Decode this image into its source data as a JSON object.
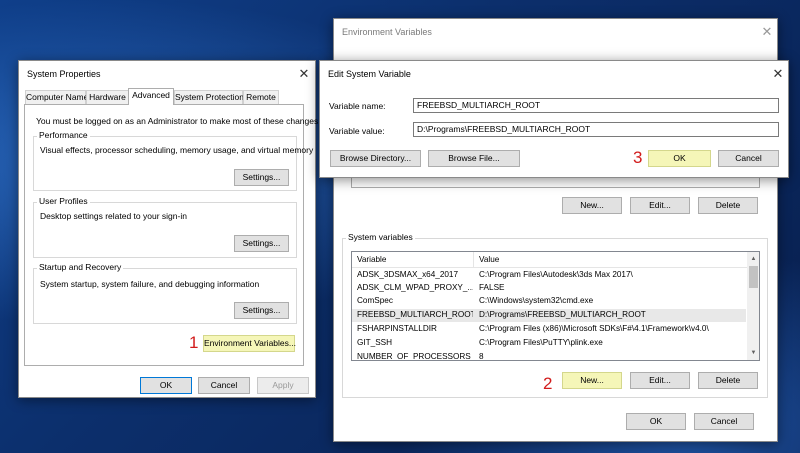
{
  "sysprops": {
    "title": "System Properties",
    "tabs": [
      "Computer Name",
      "Hardware",
      "Advanced",
      "System Protection",
      "Remote"
    ],
    "admin_note": "You must be logged on as an Administrator to make most of these changes.",
    "performance": {
      "label": "Performance",
      "desc": "Visual effects, processor scheduling, memory usage, and virtual memory",
      "button": "Settings..."
    },
    "user_profiles": {
      "label": "User Profiles",
      "desc": "Desktop settings related to your sign-in",
      "button": "Settings..."
    },
    "startup": {
      "label": "Startup and Recovery",
      "desc": "System startup, system failure, and debugging information",
      "button": "Settings..."
    },
    "env_button": "Environment Variables...",
    "ok": "OK",
    "cancel": "Cancel",
    "apply": "Apply"
  },
  "envvars": {
    "title": "Environment Variables",
    "user_buttons": {
      "new": "New...",
      "edit": "Edit...",
      "delete": "Delete"
    },
    "system_label": "System variables",
    "columns": [
      "Variable",
      "Value"
    ],
    "rows": [
      {
        "name": "ADSK_3DSMAX_x64_2017",
        "value": "C:\\Program Files\\Autodesk\\3ds Max 2017\\"
      },
      {
        "name": "ADSK_CLM_WPAD_PROXY_...",
        "value": "FALSE"
      },
      {
        "name": "ComSpec",
        "value": "C:\\Windows\\system32\\cmd.exe"
      },
      {
        "name": "FREEBSD_MULTIARCH_ROOT",
        "value": "D:\\Programs\\FREEBSD_MULTIARCH_ROOT"
      },
      {
        "name": "FSHARPINSTALLDIR",
        "value": "C:\\Program Files (x86)\\Microsoft SDKs\\F#\\4.1\\Framework\\v4.0\\"
      },
      {
        "name": "GIT_SSH",
        "value": "C:\\Program Files\\PuTTY\\plink.exe"
      },
      {
        "name": "NUMBER_OF_PROCESSORS",
        "value": "8"
      }
    ],
    "system_buttons": {
      "new": "New...",
      "edit": "Edit...",
      "delete": "Delete"
    },
    "ok": "OK",
    "cancel": "Cancel"
  },
  "editvar": {
    "title": "Edit System Variable",
    "name_label": "Variable name:",
    "name_value": "FREEBSD_MULTIARCH_ROOT",
    "value_label": "Variable value:",
    "value_value": "D:\\Programs\\FREEBSD_MULTIARCH_ROOT",
    "browse_dir": "Browse Directory...",
    "browse_file": "Browse File...",
    "ok": "OK",
    "cancel": "Cancel"
  },
  "steps": [
    "1",
    "2",
    "3"
  ],
  "colors": {
    "highlight": "#f5f6b8",
    "step_number": "#d21c1c",
    "accent": "#0078d7"
  }
}
